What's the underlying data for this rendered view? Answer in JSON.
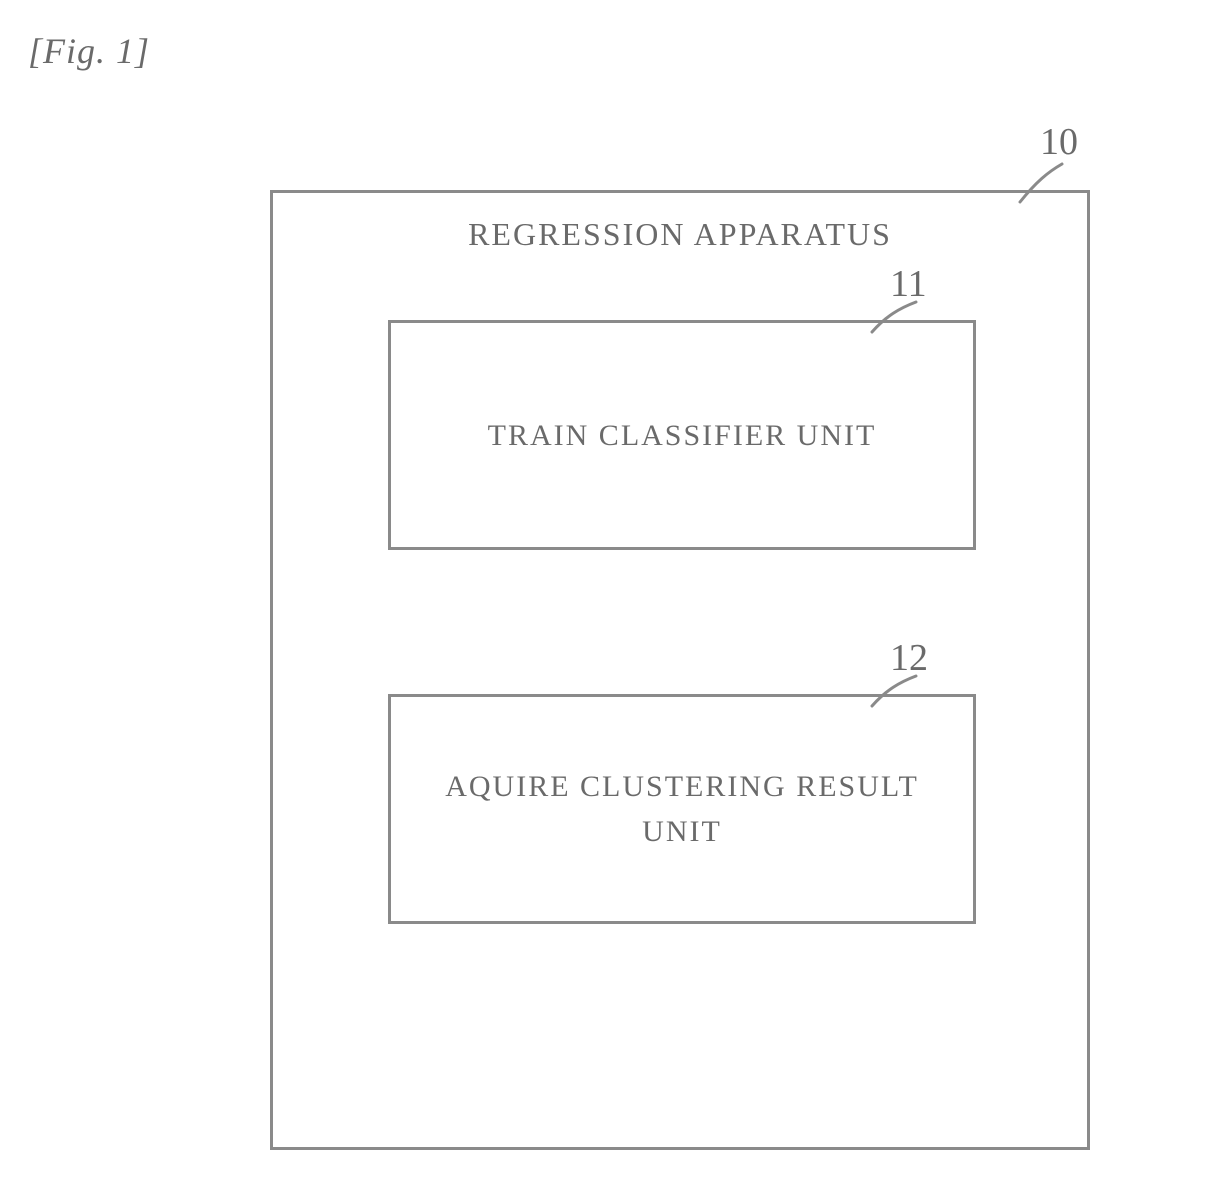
{
  "figure": {
    "label": "[Fig. 1]",
    "apparatus_num": "10",
    "apparatus_title": "REGRESSION APPARATUS",
    "unit1_num": "11",
    "unit1_label": "TRAIN CLASSIFIER UNIT",
    "unit2_num": "12",
    "unit2_label": "AQUIRE CLUSTERING RESULT UNIT"
  }
}
